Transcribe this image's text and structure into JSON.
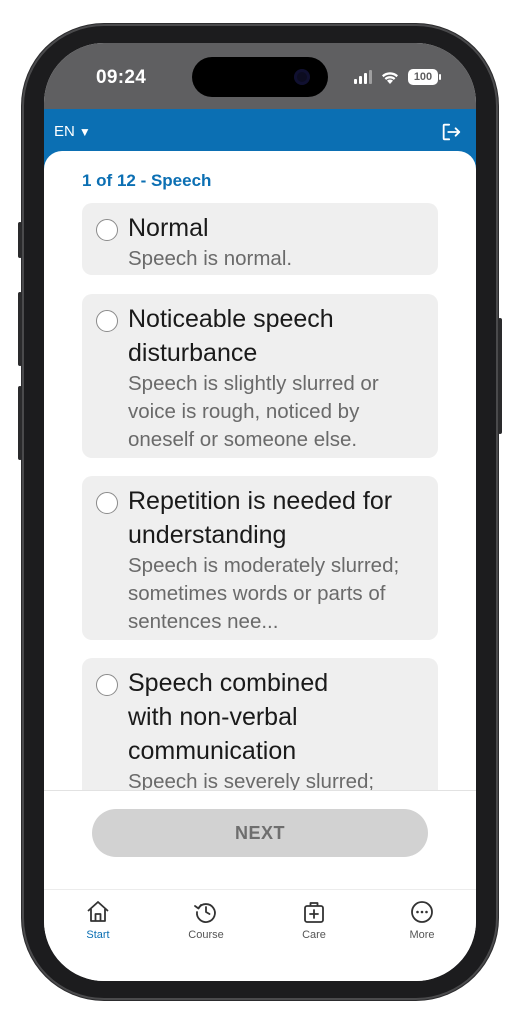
{
  "status": {
    "time": "09:24",
    "battery": "100"
  },
  "header": {
    "language": "EN",
    "language_caret": "▼"
  },
  "question": {
    "title": "1 of 12 - Speech"
  },
  "options": [
    {
      "title": "Normal",
      "desc": "Speech is normal."
    },
    {
      "title": "Noticeable speech disturbance",
      "desc": "Speech is slightly slurred or voice is rough, noticed by oneself or someone else."
    },
    {
      "title": "Repetition is needed for understanding",
      "desc": "Speech is moderately slurred; sometimes words or parts of sentences nee..."
    },
    {
      "title": "Speech combined with non-verbal communication",
      "desc": "Speech is severely slurred;"
    }
  ],
  "actions": {
    "next_label": "NEXT"
  },
  "tabs": [
    {
      "label": "Start",
      "icon": "home-icon",
      "active": true
    },
    {
      "label": "Course",
      "icon": "history-icon",
      "active": false
    },
    {
      "label": "Care",
      "icon": "medical-kit-icon",
      "active": false
    },
    {
      "label": "More",
      "icon": "more-icon",
      "active": false
    }
  ],
  "colors": {
    "accent": "#0b6fb3",
    "option_bg": "#efefef",
    "next_bg": "#d2d2d2"
  }
}
